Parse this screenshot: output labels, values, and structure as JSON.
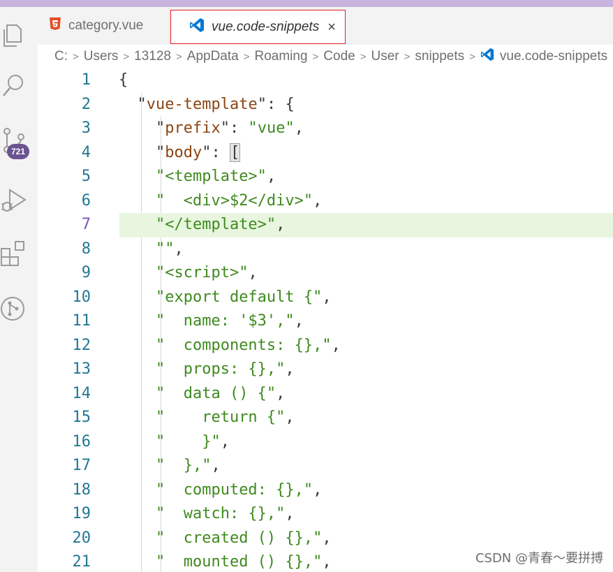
{
  "tabs": [
    {
      "label": "category.vue",
      "icon": "html5-icon",
      "active": false
    },
    {
      "label": "vue.code-snippets",
      "icon": "vscode-icon",
      "active": true,
      "close": "×"
    }
  ],
  "breadcrumb": {
    "items": [
      "C:",
      "Users",
      "13128",
      "AppData",
      "Roaming",
      "Code",
      "User",
      "snippets",
      "vue.code-snippets"
    ],
    "separator": ">"
  },
  "activity_bar": {
    "icons": [
      "explorer-icon",
      "search-icon",
      "source-control-icon",
      "run-debug-icon",
      "extensions-icon",
      "git-graph-icon"
    ],
    "source_control_badge": "721"
  },
  "editor": {
    "current_line": 7,
    "lines": [
      {
        "n": "1",
        "code": "{"
      },
      {
        "n": "2",
        "code": "  \"vue-template\": {"
      },
      {
        "n": "3",
        "code": "    \"prefix\": \"vue\","
      },
      {
        "n": "4",
        "code": "    \"body\": ["
      },
      {
        "n": "5",
        "code": "    \"<template>\","
      },
      {
        "n": "6",
        "code": "    \"  <div>$2</div>\","
      },
      {
        "n": "7",
        "code": "    \"</template>\","
      },
      {
        "n": "8",
        "code": "    \"\","
      },
      {
        "n": "9",
        "code": "    \"<script>\","
      },
      {
        "n": "10",
        "code": "    \"export default {\","
      },
      {
        "n": "11",
        "code": "    \"  name: '$3',\","
      },
      {
        "n": "12",
        "code": "    \"  components: {},\","
      },
      {
        "n": "13",
        "code": "    \"  props: {},\","
      },
      {
        "n": "14",
        "code": "    \"  data () {\","
      },
      {
        "n": "15",
        "code": "    \"    return {\","
      },
      {
        "n": "16",
        "code": "    \"    }\","
      },
      {
        "n": "17",
        "code": "    \"  },\","
      },
      {
        "n": "18",
        "code": "    \"  computed: {},\","
      },
      {
        "n": "19",
        "code": "    \"  watch: {},\","
      },
      {
        "n": "20",
        "code": "    \"  created () {},\","
      },
      {
        "n": "21",
        "code": "    \"  mounted () {},\","
      }
    ]
  },
  "watermark": "CSDN @青春～要拼搏",
  "colors": {
    "key": "#a31515",
    "string": "#3f8a1f",
    "line_number": "#237893",
    "current_line_bg": "#e8f6df",
    "badge": "#6a5390",
    "active_tab_border": "#e51c23"
  }
}
